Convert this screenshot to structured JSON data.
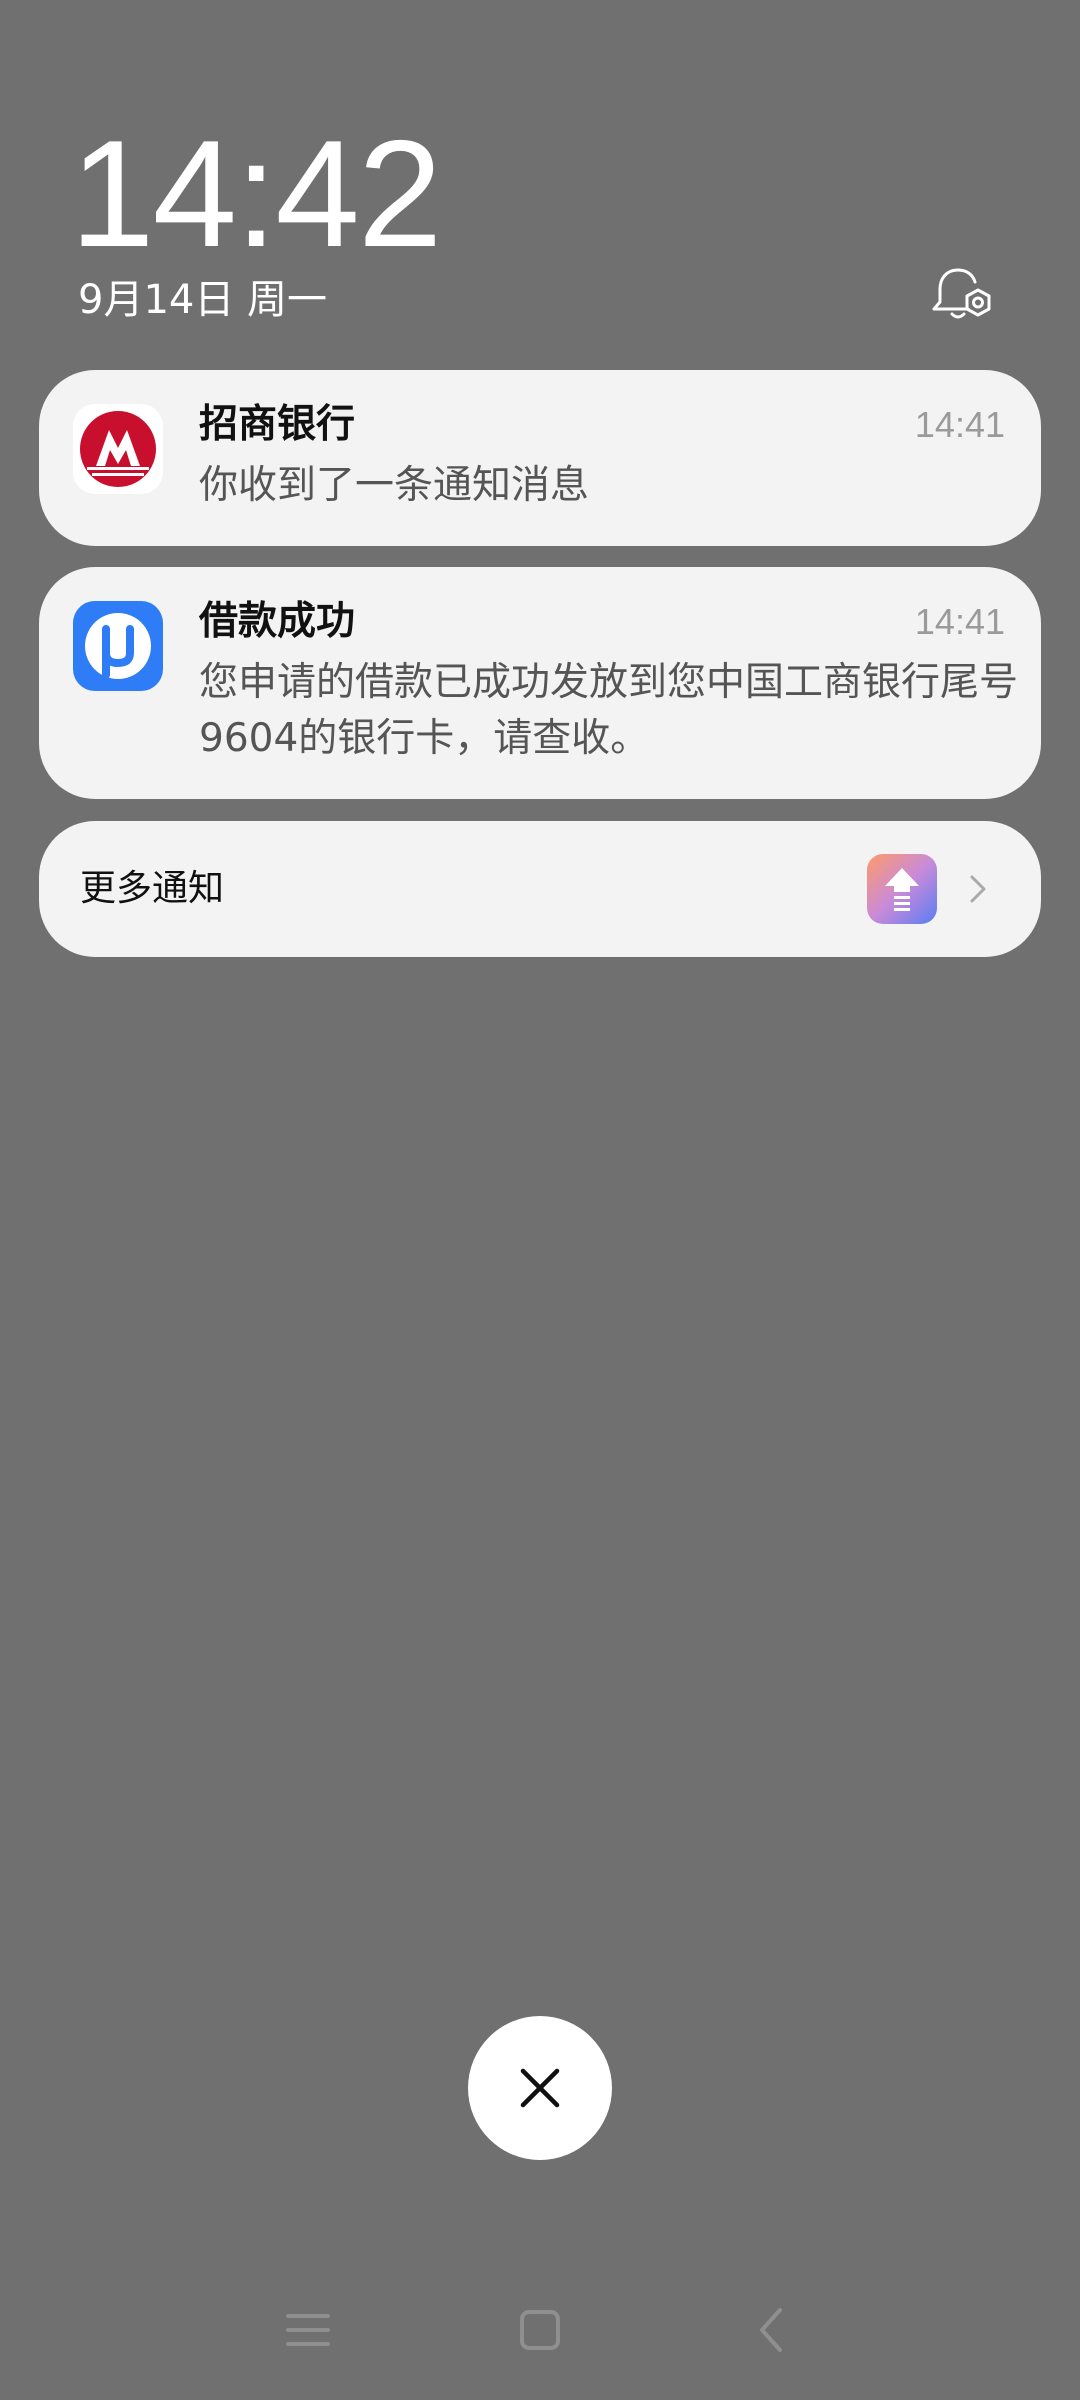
{
  "lockscreen": {
    "time": "14:42",
    "date": "9月14日 周一"
  },
  "notifications": [
    {
      "app_icon": "cmb-bank-logo-icon",
      "title": "招商银行",
      "time": "14:41",
      "body": "你收到了一条通知消息"
    },
    {
      "app_icon": "loan-app-u-icon",
      "title": "借款成功",
      "time": "14:41",
      "body": "您申请的借款已成功发放到您中国工商银行尾号9604的银行卡，请查收。"
    }
  ],
  "more": {
    "label": "更多通知",
    "app_icon": "upload-app-icon"
  },
  "colors": {
    "background": "#707070",
    "card": "#f3f3f3",
    "cmb_red": "#c8102e",
    "loan_blue": "#2e7cf6"
  }
}
